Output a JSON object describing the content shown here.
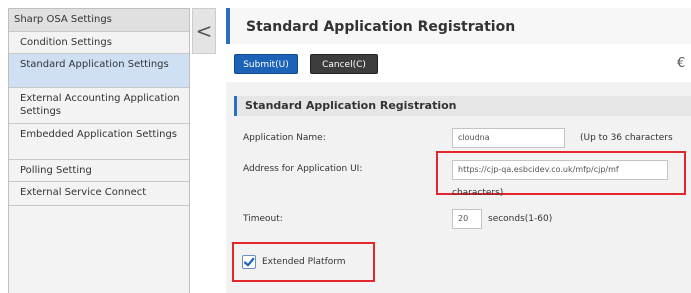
{
  "sidebar": {
    "header": "Sharp OSA Settings",
    "items": [
      {
        "label": "Condition Settings",
        "selected": false
      },
      {
        "label": "Standard Application Settings",
        "selected": true
      },
      {
        "label": "External Accounting Application Settings",
        "selected": false
      },
      {
        "label": "Embedded Application Settings",
        "selected": false
      },
      {
        "label": "Polling Setting",
        "selected": false
      },
      {
        "label": "External Service Connect",
        "selected": false
      }
    ]
  },
  "collapse": {
    "glyph": "<"
  },
  "header": {
    "title": "Standard Application Registration",
    "submit_label": "Submit(U)",
    "cancel_label": "Cancel(C)",
    "right_icon": "€"
  },
  "section": {
    "title": "Standard Application Registration"
  },
  "form": {
    "app_name_label": "Application Name:",
    "app_name_value": "cloudna",
    "app_name_note": "(Up to 36 characters",
    "address_label": "Address for Application UI:",
    "address_value": "https://cjp-qa.esbcidev.co.uk/mfp/cjp/mf",
    "address_note_tail": "characters)",
    "timeout_label": "Timeout:",
    "timeout_value": "20",
    "timeout_note": "seconds(1-60)",
    "extended_label": "Extended Platform",
    "extended_checked": true
  },
  "colors": {
    "accent": "#2a6fbf",
    "highlight": "#e3262b",
    "selected_bg": "#cfe0f5",
    "submit_bg": "#1c63b7",
    "cancel_bg": "#3d3d3d"
  }
}
